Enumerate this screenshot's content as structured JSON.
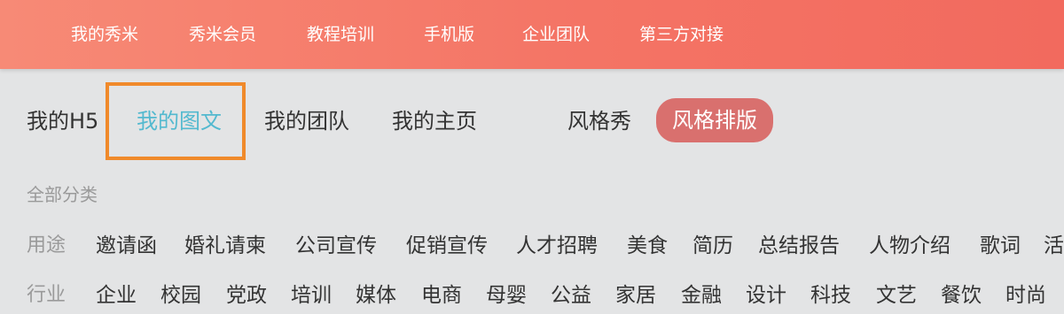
{
  "top_nav": {
    "items": [
      "我的秀米",
      "秀米会员",
      "教程培训",
      "手机版",
      "企业团队",
      "第三方对接"
    ]
  },
  "tabs": {
    "items": [
      "我的H5",
      "我的图文",
      "我的团队",
      "我的主页",
      "风格秀",
      "风格排版"
    ],
    "selected_highlighted": "我的图文",
    "pill_active": "风格排版"
  },
  "categories": {
    "title": "全部分类",
    "usage_label": "用途",
    "usage_items": [
      "邀请函",
      "婚礼请柬",
      "公司宣传",
      "促销宣传",
      "人才招聘",
      "美食",
      "简历",
      "总结报告",
      "人物介绍",
      "歌词",
      "活"
    ],
    "industry_label": "行业",
    "industry_items": [
      "企业",
      "校园",
      "党政",
      "培训",
      "媒体",
      "电商",
      "母婴",
      "公益",
      "家居",
      "金融",
      "设计",
      "科技",
      "文艺",
      "餐饮",
      "时尚"
    ]
  },
  "colors": {
    "topbar_start": "#f78a76",
    "topbar_end": "#f26a5e",
    "highlight_box": "#f08a2b",
    "active_tab_text": "#53b9cf",
    "pill_bg": "#d9706e"
  }
}
